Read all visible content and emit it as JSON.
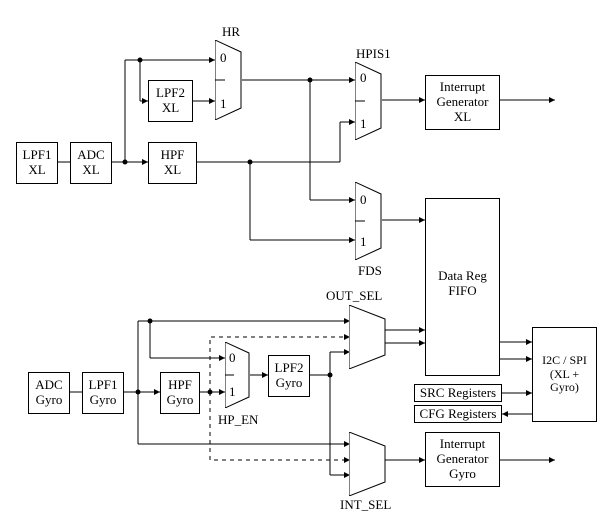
{
  "blocks": {
    "lpf1_xl": {
      "l1": "LPF1",
      "l2": "XL"
    },
    "adc_xl": {
      "l1": "ADC",
      "l2": "XL"
    },
    "lpf2_xl": {
      "l1": "LPF2",
      "l2": "XL"
    },
    "hpf_xl": {
      "l1": "HPF",
      "l2": "XL"
    },
    "int_gen_xl": {
      "l1": "Interrupt",
      "l2": "Generator",
      "l3": "XL"
    },
    "adc_gy": {
      "l1": "ADC",
      "l2": "Gyro"
    },
    "lpf1_gy": {
      "l1": "LPF1",
      "l2": "Gyro"
    },
    "hpf_gy": {
      "l1": "HPF",
      "l2": "Gyro"
    },
    "lpf2_gy": {
      "l1": "LPF2",
      "l2": "Gyro"
    },
    "int_gen_gy": {
      "l1": "Interrupt",
      "l2": "Generator",
      "l3": "Gyro"
    },
    "data_reg": {
      "l1": "Data Reg",
      "l2": "FIFO"
    },
    "src_reg": "SRC Registers",
    "cfg_reg": "CFG Registers",
    "i2c_spi": {
      "l1": "I2C / SPI",
      "l2": "(XL + Gyro)"
    }
  },
  "mux_labels": {
    "hr": "HR",
    "hpis1": "HPIS1",
    "fds": "FDS",
    "out_sel": "OUT_SEL",
    "hp_en": "HP_EN",
    "int_sel": "INT_SEL",
    "zero": "0",
    "one": "1"
  }
}
